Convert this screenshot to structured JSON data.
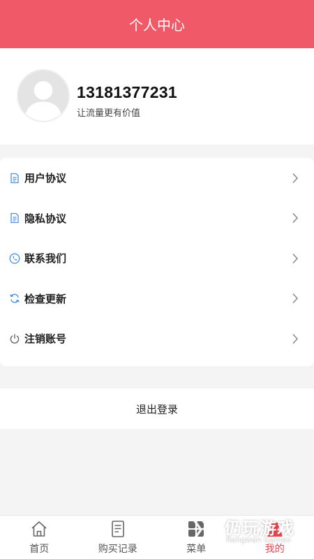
{
  "header": {
    "title": "个人中心"
  },
  "profile": {
    "phone": "13181377231",
    "tagline": "让流量更有价值"
  },
  "menu": {
    "items": [
      {
        "label": "用户协议",
        "icon": "document-icon"
      },
      {
        "label": "隐私协议",
        "icon": "document-icon"
      },
      {
        "label": "联系我们",
        "icon": "phone-icon"
      },
      {
        "label": "检查更新",
        "icon": "refresh-icon"
      },
      {
        "label": "注销账号",
        "icon": "power-icon"
      }
    ]
  },
  "logout": {
    "label": "退出登录"
  },
  "tabbar": {
    "tabs": [
      {
        "label": "首页",
        "icon": "home-icon"
      },
      {
        "label": "购买记录",
        "icon": "receipt-icon"
      },
      {
        "label": "菜单",
        "icon": "grid-icon"
      },
      {
        "label": "我的",
        "icon": "user-icon",
        "active": true
      }
    ]
  },
  "watermark": {
    "title": "仍玩游戏",
    "subtitle": "Rengwan Games"
  },
  "colors": {
    "header_bg": "#f05968",
    "accent": "#e8454f",
    "icon_blue": "#4a90e2",
    "page_bg": "#f4f4f4"
  }
}
